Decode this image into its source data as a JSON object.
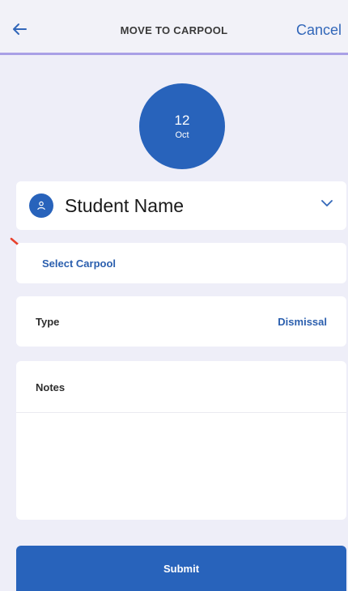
{
  "header": {
    "title": "MOVE TO CARPOOL",
    "cancel_label": "Cancel",
    "back_icon": "arrow-left-icon"
  },
  "date": {
    "day": "12",
    "month": "Oct"
  },
  "student": {
    "name": "Student Name",
    "avatar_icon": "person-icon",
    "dropdown_icon": "chevron-down-icon"
  },
  "carpool": {
    "label": "Select Carpool"
  },
  "type": {
    "label": "Type",
    "value": "Dismissal"
  },
  "notes": {
    "label": "Notes",
    "value": ""
  },
  "submit": {
    "label": "Submit"
  },
  "colors": {
    "primary": "#2863bb",
    "accent_text": "#2b5fae",
    "header_rule": "#a9a0e6",
    "background": "#eeeef8",
    "annotation_arrow": "#e8412c"
  }
}
